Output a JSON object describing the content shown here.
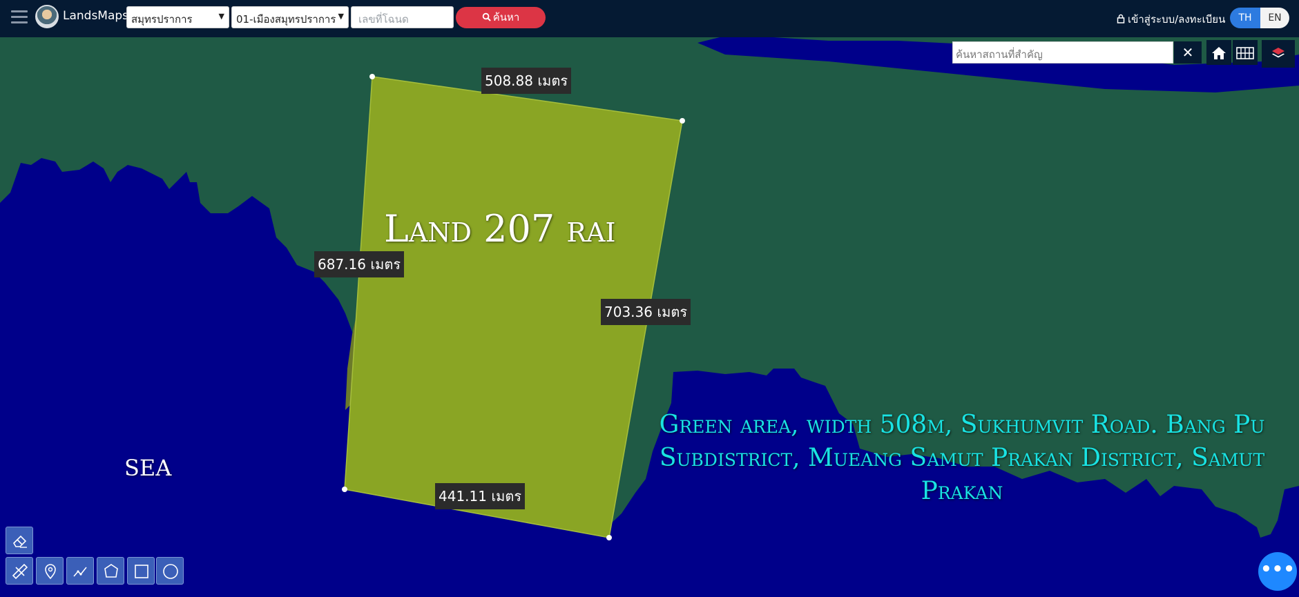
{
  "header": {
    "brand": "LandsMaps",
    "province": "สมุทรปราการ",
    "district": "01-เมืองสมุทรปราการ",
    "deed_placeholder": "เลขที่โฉนด",
    "search_label": "ค้นหา",
    "login_label": "เข้าสู่ระบบ/ลงทะเบียน",
    "lang_th": "TH",
    "lang_en": "EN"
  },
  "map_tools": {
    "place_search_placeholder": "ค้นหาสถานที่สำคัญ",
    "clear_label": "✕"
  },
  "measurements": {
    "top": "508.88 เมตร",
    "left": "687.16 เมตร",
    "right": "703.36 เมตร",
    "bottom": "441.11 เมตร"
  },
  "annotations": {
    "title": "Land 207 rai",
    "sea": "sea",
    "description": "Green area, width 508m, Sukhumvit Road. Bang Pu Subdistrict, Mueang Samut Prakan District, Samut Prakan"
  },
  "colors": {
    "header_bg": "#051a33",
    "sea": "#00008a",
    "land": "#1f5a45",
    "parcel": "#8aa524",
    "accent_red": "#dc3545",
    "accent_blue": "#2d7be0",
    "description_text": "#19e3e3"
  },
  "icons": {
    "menu": "hamburger-icon",
    "search": "search-icon",
    "lock": "lock-icon",
    "home": "home-icon",
    "grid": "grid-icon",
    "layers": "layers-icon",
    "eraser": "eraser-icon",
    "ruler": "ruler-icon",
    "pin": "pin-icon",
    "polyline": "polyline-icon",
    "polygon": "polygon-icon",
    "rectangle": "rectangle-icon",
    "circle": "circle-icon",
    "more": "more-icon"
  }
}
